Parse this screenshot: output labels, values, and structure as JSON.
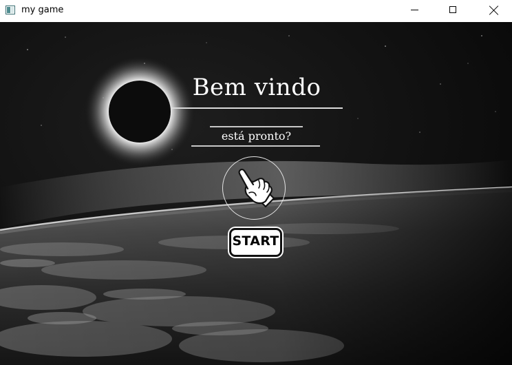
{
  "window": {
    "title": "my game",
    "controls": [
      "minimize",
      "maximize",
      "close"
    ]
  },
  "scene": {
    "background": "space-eclipse-earth",
    "heading": "Bem vindo",
    "subtitle": "está pronto?",
    "pointer_icon": "pointing-hand-icon",
    "start_label": "START"
  },
  "colors": {
    "titlebar": "#ffffff",
    "text": "#ffffff",
    "button_bg": "#ffffff",
    "button_border": "#111111"
  }
}
